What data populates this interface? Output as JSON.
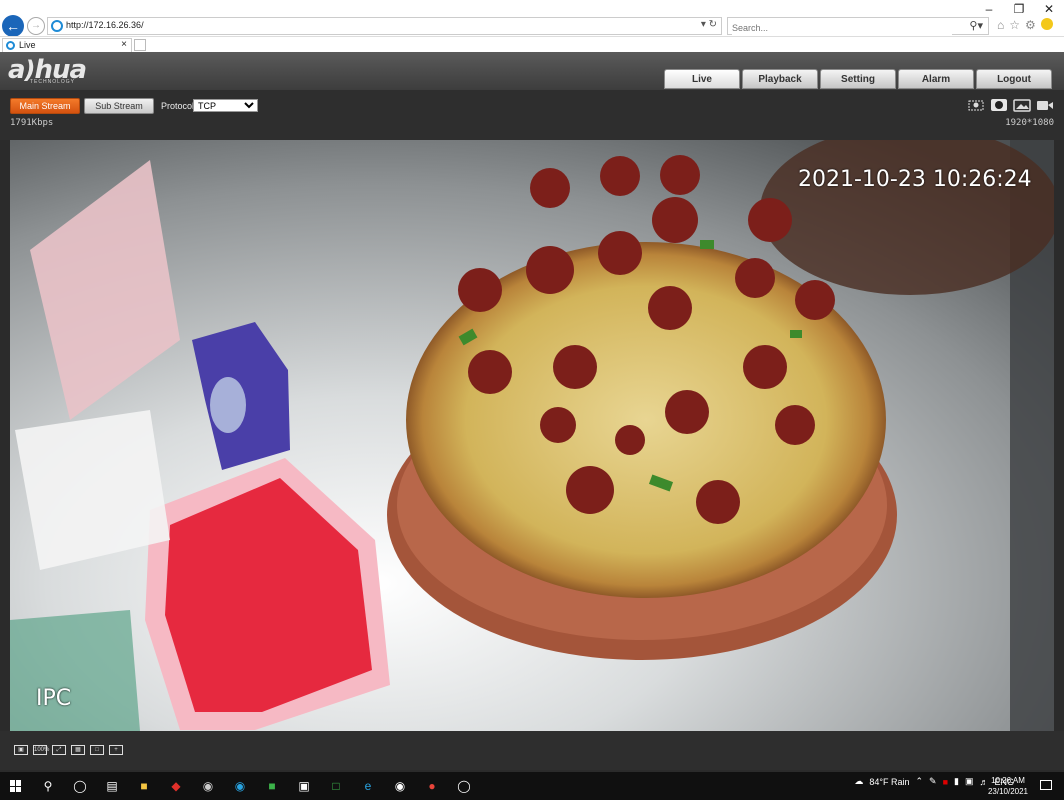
{
  "browser": {
    "url": "http://172.16.26.36/",
    "search_placeholder": "Search...",
    "tab_title": "Live",
    "tab_close": "×",
    "window_controls": [
      "–",
      "❐",
      "✕"
    ]
  },
  "header": {
    "logo": "a)hua",
    "logo_sub": "TECHNOLOGY",
    "nav": [
      "Live",
      "Playback",
      "Setting",
      "Alarm",
      "Logout"
    ],
    "active_nav": "Live"
  },
  "toolbar": {
    "main_stream": "Main Stream",
    "sub_stream": "Sub Stream",
    "protocol_label": "Protocol",
    "protocol_value": "TCP",
    "bitrate": "1791Kbps",
    "resolution": "1920*1080"
  },
  "video": {
    "timestamp": "2021-10-23 10:26:24",
    "channel_name": "IPC"
  },
  "video_tools": {
    "zoom_label": "100%"
  },
  "taskbar": {
    "weather": "84°F  Rain",
    "language": "ENG",
    "time": "10:26 AM",
    "date": "23/10/2021"
  }
}
